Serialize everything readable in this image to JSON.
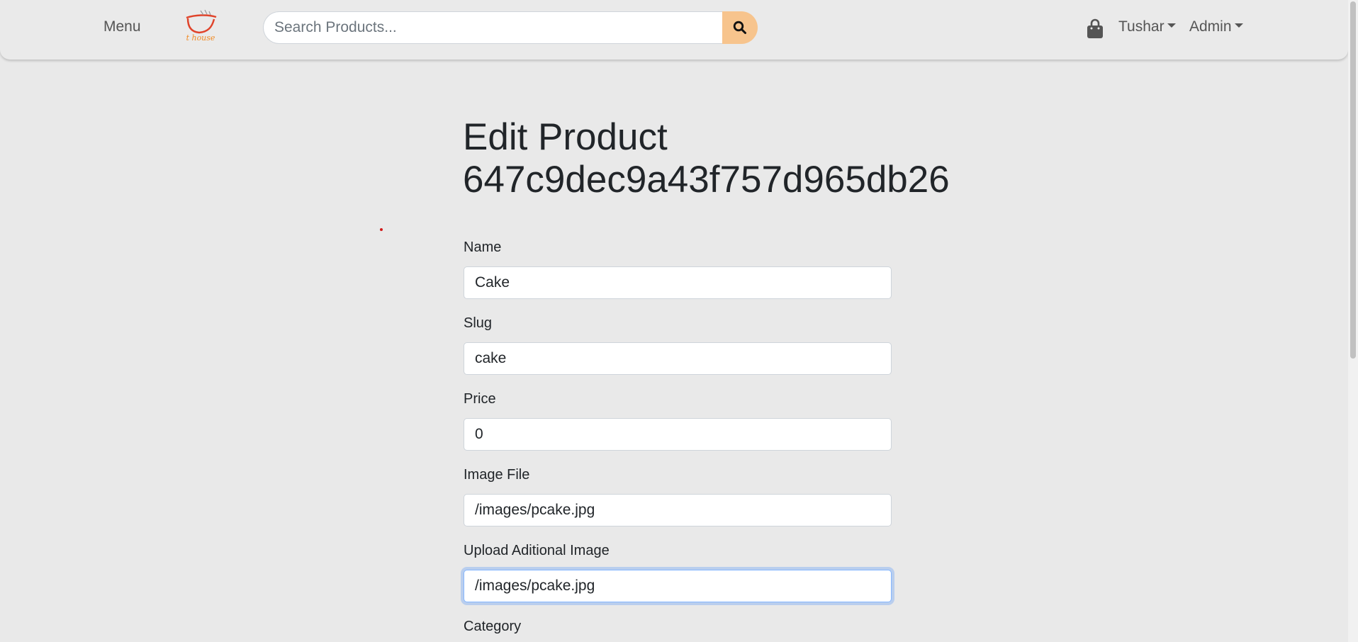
{
  "navbar": {
    "menu_label": "Menu",
    "logo_text": "t house",
    "search_placeholder": "Search Products...",
    "search_icon": "search-icon",
    "cart_icon": "shopping-bag-icon",
    "user_dropdown": "Tushar",
    "admin_dropdown": "Admin"
  },
  "page": {
    "title_line1": "Edit Product",
    "title_line2": "647c9dec9a43f757d965db26"
  },
  "form": {
    "name": {
      "label": "Name",
      "value": "Cake"
    },
    "slug": {
      "label": "Slug",
      "value": "cake"
    },
    "price": {
      "label": "Price",
      "value": "0"
    },
    "image_file": {
      "label": "Image File",
      "value": "/images/pcake.jpg"
    },
    "additional_image": {
      "label": "Upload Aditional Image",
      "value": "/images/pcake.jpg"
    },
    "category": {
      "label": "Category"
    }
  },
  "colors": {
    "background": "#e9e9e9",
    "search_button": "#f7c48d",
    "focus_ring": "#86b7fe"
  }
}
